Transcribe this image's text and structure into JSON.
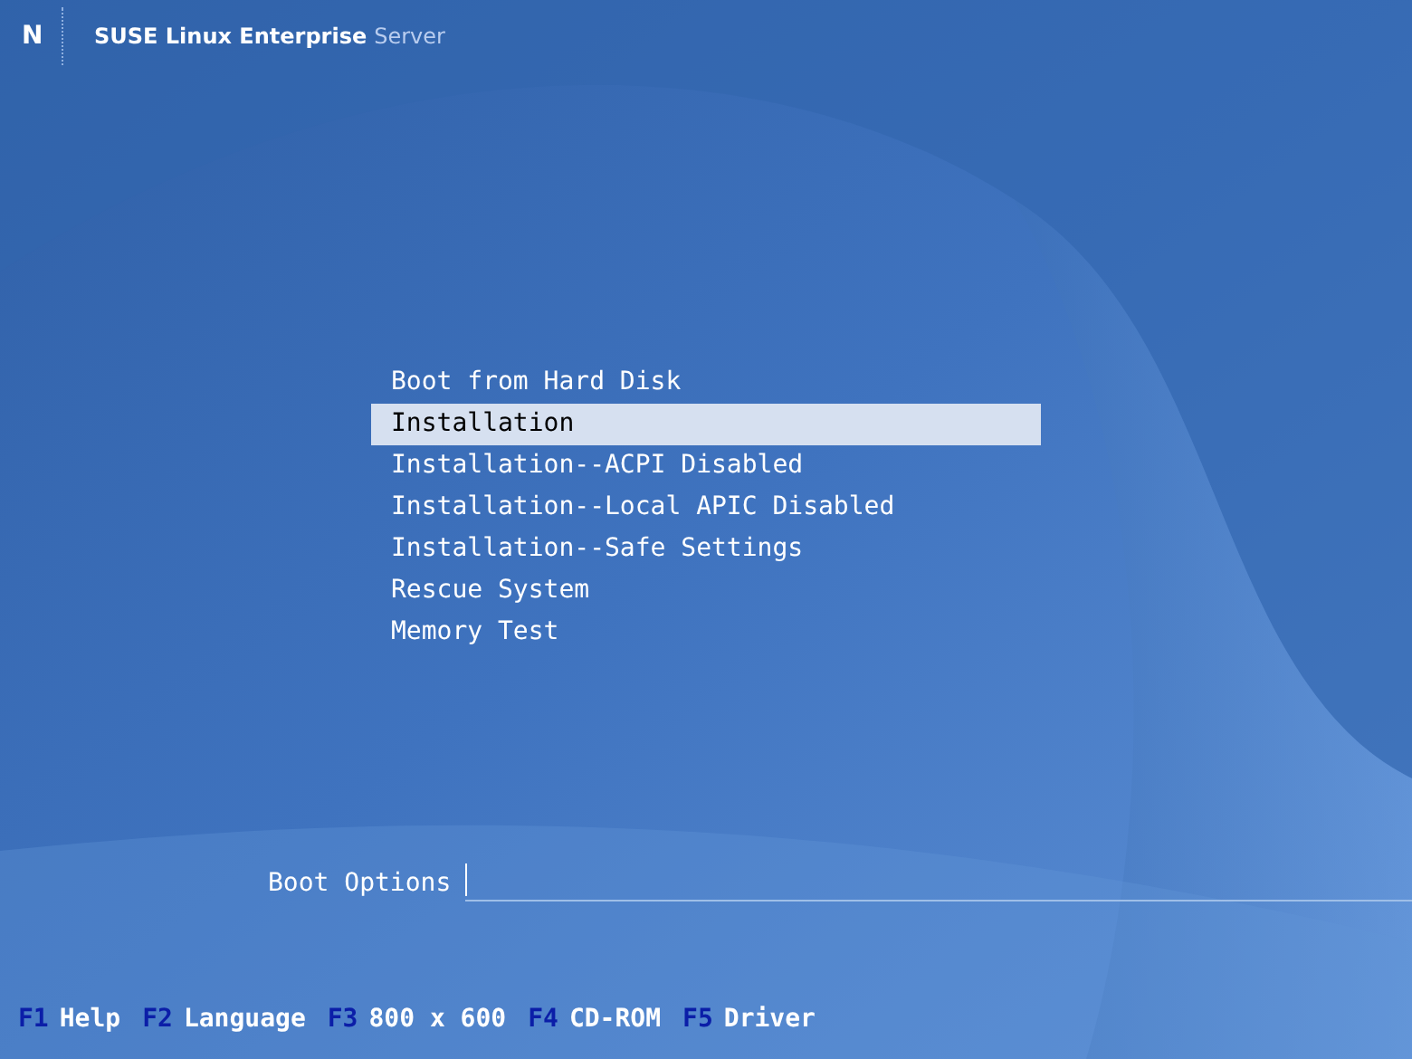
{
  "header": {
    "logo_mark": "N",
    "product": "SUSE Linux Enterprise",
    "edition": "Server"
  },
  "menu": [
    {
      "label": "Boot from Hard Disk",
      "selected": false
    },
    {
      "label": "Installation",
      "selected": true
    },
    {
      "label": "Installation--ACPI Disabled",
      "selected": false
    },
    {
      "label": "Installation--Local APIC Disabled",
      "selected": false
    },
    {
      "label": "Installation--Safe Settings",
      "selected": false
    },
    {
      "label": "Rescue System",
      "selected": false
    },
    {
      "label": "Memory Test",
      "selected": false
    }
  ],
  "boot_options": {
    "label": "Boot Options"
  },
  "function_keys": [
    {
      "key": "F1",
      "label": "Help"
    },
    {
      "key": "F2",
      "label": "Language"
    },
    {
      "key": "F3",
      "label": "800 x 600"
    },
    {
      "key": "F4",
      "label": "CD-ROM"
    },
    {
      "key": "F5",
      "label": "Driver"
    }
  ]
}
